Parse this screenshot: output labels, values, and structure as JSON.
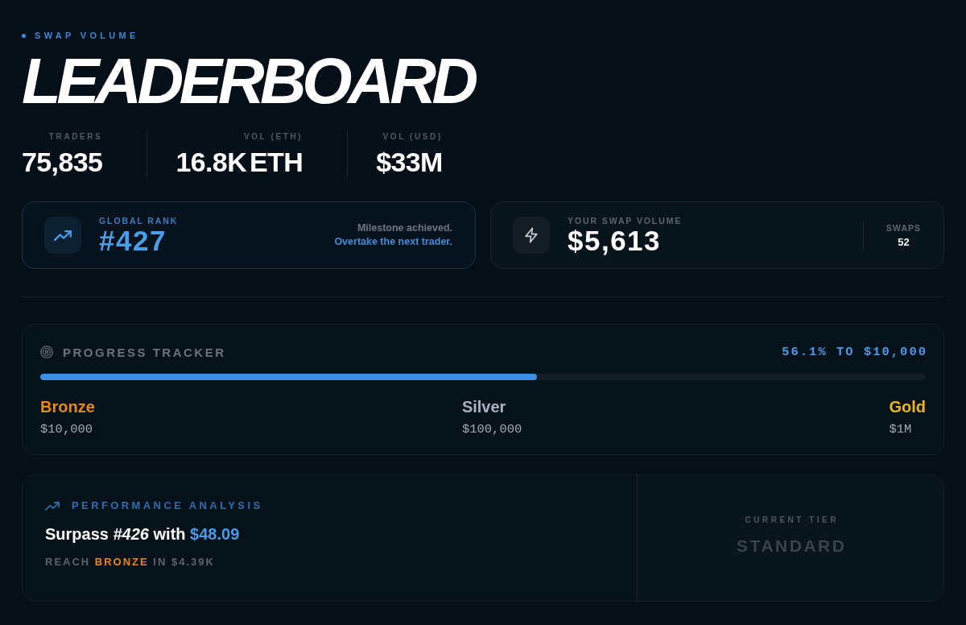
{
  "header": {
    "eyebrow": "SWAP VOLUME",
    "title": "LEADERBOARD"
  },
  "stats": [
    {
      "label": "TRADERS",
      "value": "75,835"
    },
    {
      "label": "VOL (ETH)",
      "value": "16.8K ETH"
    },
    {
      "label": "VOL (USD)",
      "value": "$33M"
    }
  ],
  "cards": [
    {
      "kind": "rank",
      "label": "GLOBAL RANK",
      "value": "#427",
      "note": "Milestone achieved.",
      "hint": "Overtake the next trader."
    },
    {
      "kind": "volume",
      "label": "YOUR SWAP VOLUME",
      "value": "$5,613",
      "side_label": "SWAPS",
      "side_value": "52"
    }
  ],
  "progress": {
    "title": "PROGRESS TRACKER",
    "reading": "56.1% TO $10,000",
    "level": 0.561,
    "tiers": [
      {
        "name": "Bronze",
        "threshold": "$10,000",
        "color": "#e8871a"
      },
      {
        "name": "Silver",
        "threshold": "$100,000",
        "color": "#a9b4c2"
      },
      {
        "name": "Gold",
        "threshold": "$1M",
        "color": "#f0b41e"
      }
    ]
  },
  "performance": {
    "title": "PERFORMANCE ANALYSIS",
    "headline": "Surpass *#426* with **$48.09**",
    "goal": "REACH **BRONZE** IN $4.39K",
    "tier_label": "CURRENT TIER",
    "tier": "STANDARD"
  }
}
